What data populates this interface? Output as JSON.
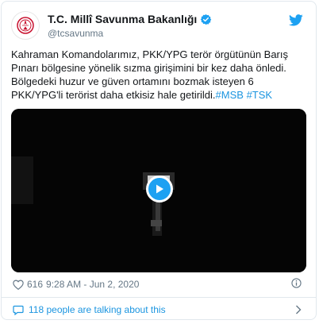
{
  "header": {
    "display_name": "T.C. Millî Savunma Bakanlığı",
    "handle": "@tcsavunma",
    "avatar_icon": "ministry-emblem-icon",
    "verified_icon": "verified-badge-icon",
    "brand_icon": "twitter-bird-icon"
  },
  "tweet": {
    "line1": "Kahraman Komandolarımız, PKK/YPG terör örgütünün Barış",
    "line2": "Pınarı bölgesine yönelik sızma girişimini bir kez daha önledi.",
    "line3": "Bölgedeki huzur ve güven ortamını bozmak isteyen 6",
    "line4_text": "PKK/YPG'li terörist daha etkisiz hale getirildi.",
    "hashtag1": "#MSB",
    "hashtag2": "#TSK"
  },
  "media": {
    "type": "video",
    "play_icon": "play-icon"
  },
  "meta": {
    "likes": "616",
    "timestamp": "9:28 AM - Jun 2, 2020",
    "like_icon": "heart-icon",
    "info_icon": "info-icon"
  },
  "footer": {
    "talking_text": "118 people are talking about this",
    "comment_icon": "speech-bubble-icon",
    "chevron_icon": "chevron-right-icon"
  },
  "colors": {
    "accent": "#1da1f2",
    "link": "#1b95e0",
    "muted": "#657786",
    "emblem_red": "#c8102e"
  }
}
